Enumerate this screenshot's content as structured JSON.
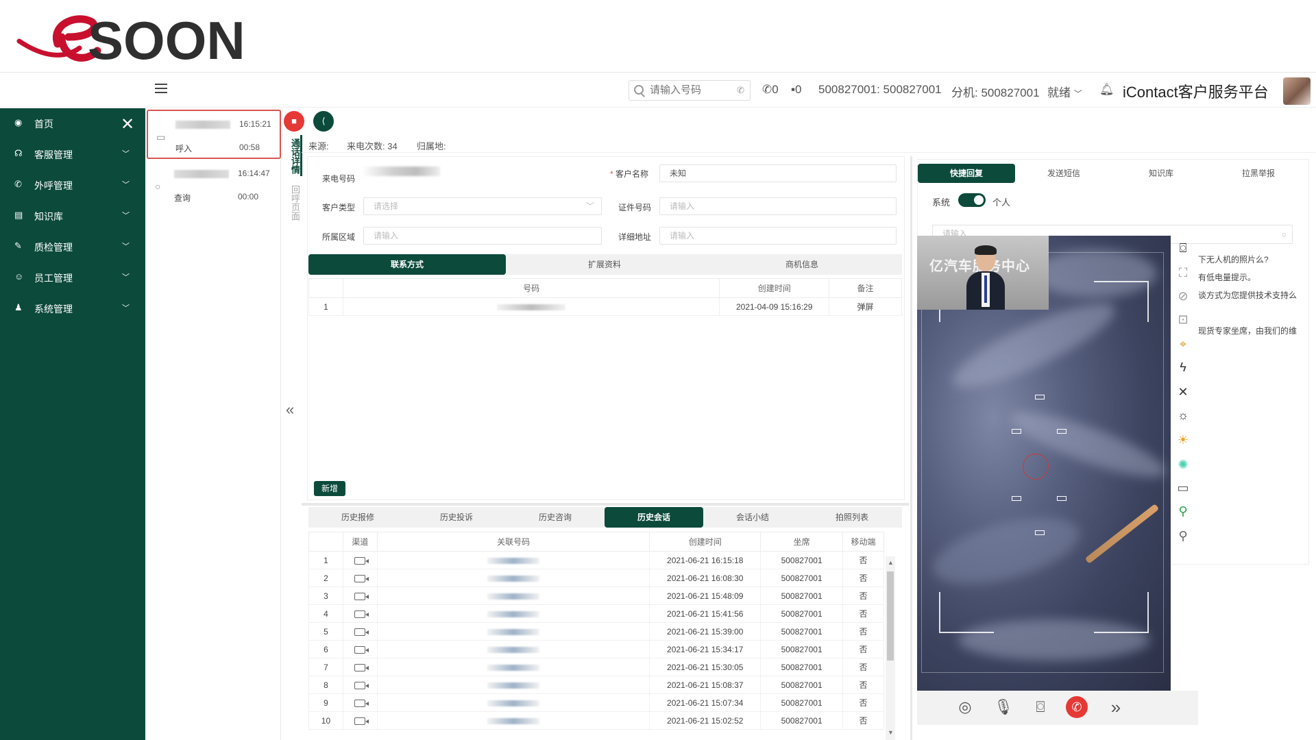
{
  "brand": {
    "logo_text": "SOON"
  },
  "header": {
    "search_placeholder": "请输入号码",
    "call_count": "0",
    "msg_count": "0",
    "agent": "500827001: 500827001",
    "ext": "分机: 500827001",
    "status": "就绪",
    "platform": "iContact客户服务平台"
  },
  "sidebar": {
    "items": [
      {
        "label": "首页",
        "icon": "dashboard-icon"
      },
      {
        "label": "客服管理",
        "icon": "headset-icon"
      },
      {
        "label": "外呼管理",
        "icon": "phone-icon"
      },
      {
        "label": "知识库",
        "icon": "book-icon"
      },
      {
        "label": "质检管理",
        "icon": "edit-icon"
      },
      {
        "label": "员工管理",
        "icon": "staff-icon"
      },
      {
        "label": "系统管理",
        "icon": "user-icon"
      }
    ]
  },
  "sessions": [
    {
      "time": "16:15:21",
      "type": "呼入",
      "duration": "00:58",
      "icon": "video-icon"
    },
    {
      "time": "16:14:47",
      "type": "查询",
      "duration": "00:00",
      "icon": "search-icon"
    }
  ],
  "vtabs": [
    "通话详情",
    "回呼页面"
  ],
  "info": {
    "source": "来源:",
    "count": "来电次数: 34",
    "location": "归属地:"
  },
  "form": {
    "caller_label": "来电号码",
    "cust_name_label": "客户名称",
    "cust_name_value": "未知",
    "cust_type_label": "客户类型",
    "cust_type_placeholder": "请选择",
    "id_label": "证件号码",
    "id_placeholder": "请输入",
    "region_label": "所属区域",
    "region_placeholder": "请输入",
    "addr_label": "详细地址",
    "addr_placeholder": "请输入"
  },
  "contact_tabs": [
    "联系方式",
    "扩展资料",
    "商机信息"
  ],
  "contact_table": {
    "headers": [
      "号码",
      "创建时间",
      "备注"
    ],
    "rows": [
      {
        "no": "1",
        "created": "2021-04-09 15:16:29",
        "note": "弹屏"
      }
    ]
  },
  "add_button": "新增",
  "history_tabs": [
    "历史报修",
    "历史投诉",
    "历史咨询",
    "历史会话",
    "会话小结",
    "拍照列表"
  ],
  "history_table": {
    "headers": [
      "渠道",
      "关联号码",
      "创建时间",
      "坐席",
      "移动端"
    ],
    "rows": [
      {
        "no": "1",
        "created": "2021-06-21 16:15:18",
        "agent": "500827001",
        "mobile": "否"
      },
      {
        "no": "2",
        "created": "2021-06-21 16:08:30",
        "agent": "500827001",
        "mobile": "否"
      },
      {
        "no": "3",
        "created": "2021-06-21 15:48:09",
        "agent": "500827001",
        "mobile": "否"
      },
      {
        "no": "4",
        "created": "2021-06-21 15:41:56",
        "agent": "500827001",
        "mobile": "否"
      },
      {
        "no": "5",
        "created": "2021-06-21 15:39:00",
        "agent": "500827001",
        "mobile": "否"
      },
      {
        "no": "6",
        "created": "2021-06-21 15:34:17",
        "agent": "500827001",
        "mobile": "否"
      },
      {
        "no": "7",
        "created": "2021-06-21 15:30:05",
        "agent": "500827001",
        "mobile": "否"
      },
      {
        "no": "8",
        "created": "2021-06-21 15:08:37",
        "agent": "500827001",
        "mobile": "否"
      },
      {
        "no": "9",
        "created": "2021-06-21 15:07:34",
        "agent": "500827001",
        "mobile": "否"
      },
      {
        "no": "10",
        "created": "2021-06-21 15:02:52",
        "agent": "500827001",
        "mobile": "否"
      }
    ]
  },
  "right_tabs": [
    "快捷回复",
    "发送短信",
    "知识库",
    "拉黑举报"
  ],
  "right_toggle": {
    "left": "系统",
    "right": "个人"
  },
  "right_search_placeholder": "请输入",
  "snippets": [
    "下无人机的照片么?",
    "有低电量提示。",
    "谈方式为您提供技术支持么",
    "现货专家坐席，由我们的维"
  ],
  "video": {
    "pip_text": "亿汽车服务中心"
  },
  "colors": {
    "primary": "#0c4a3b",
    "danger": "#e53935",
    "logo_red": "#c8102e"
  }
}
